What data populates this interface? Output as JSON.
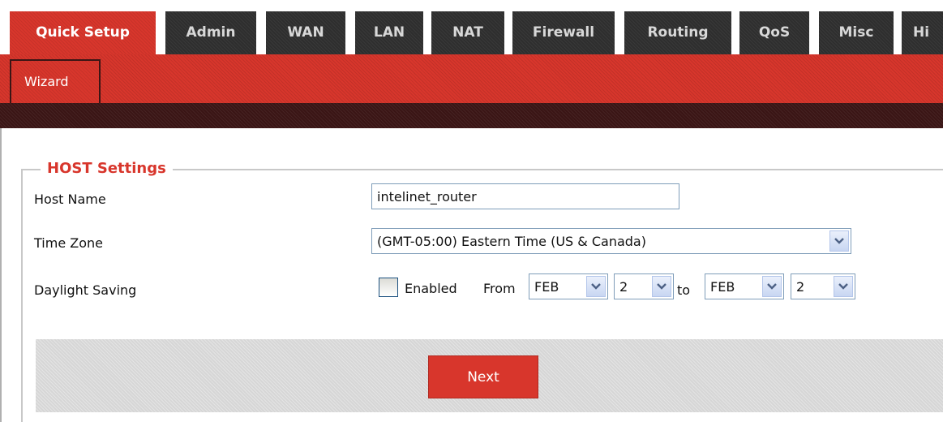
{
  "tabs": [
    {
      "label": "Quick Setup",
      "active": true
    },
    {
      "label": "Admin"
    },
    {
      "label": "WAN"
    },
    {
      "label": "LAN"
    },
    {
      "label": "NAT"
    },
    {
      "label": "Firewall"
    },
    {
      "label": "Routing"
    },
    {
      "label": "QoS"
    },
    {
      "label": "Misc"
    },
    {
      "label": "Hi"
    }
  ],
  "subtabs": {
    "wizard": "Wizard"
  },
  "section": {
    "title": "HOST Settings"
  },
  "fields": {
    "host_name_label": "Host Name",
    "host_name_value": "intelinet_router",
    "time_zone_label": "Time Zone",
    "time_zone_value": "(GMT-05:00) Eastern Time (US & Canada)",
    "daylight_label": "Daylight Saving",
    "enabled_label": "Enabled",
    "enabled_checked": false,
    "from_label": "From",
    "from_month": "FEB",
    "from_day": "2",
    "to_label": "to",
    "to_month": "FEB",
    "to_day": "2"
  },
  "buttons": {
    "next": "Next"
  },
  "colors": {
    "accent": "#d8362c",
    "tab_dark": "#2e2e2e",
    "strip_dark": "#3a1515"
  }
}
